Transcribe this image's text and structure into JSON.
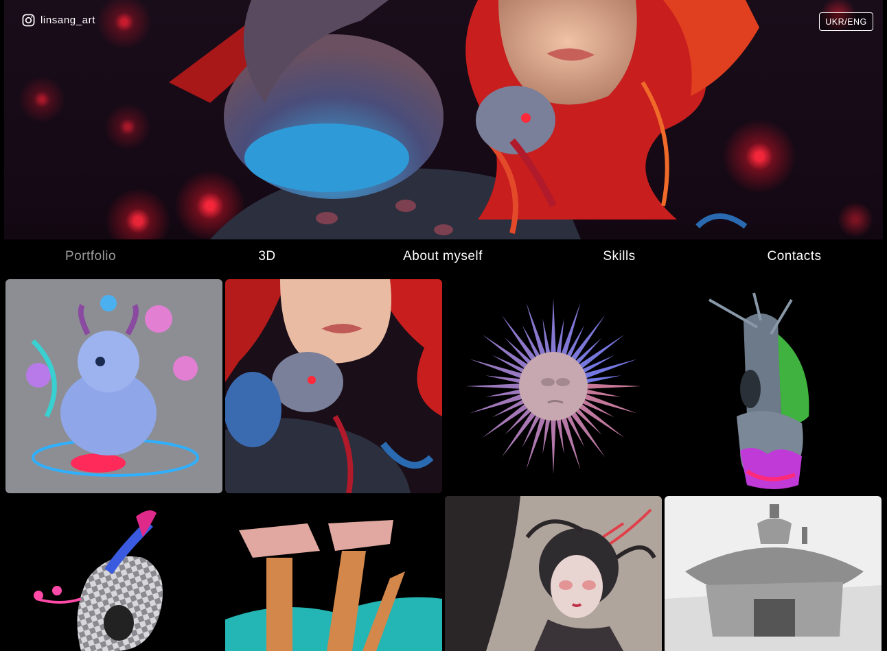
{
  "header": {
    "instagram_handle": "linsang_art",
    "instagram_icon": "instagram-icon",
    "language_toggle": "UKR/ENG"
  },
  "nav": {
    "items": [
      {
        "label": "Portfolio",
        "active": true
      },
      {
        "label": "3D",
        "active": false
      },
      {
        "label": "About myself",
        "active": false
      },
      {
        "label": "Skills",
        "active": false
      },
      {
        "label": "Contacts",
        "active": false
      }
    ]
  },
  "gallery": {
    "items": [
      {
        "name": "blue-creature-illustration"
      },
      {
        "name": "red-hair-girl-illustration"
      },
      {
        "name": "spiky-sun-3d-model"
      },
      {
        "name": "nailed-totem-3d-model"
      },
      {
        "name": "checkered-helmet-3d-model"
      },
      {
        "name": "broken-columns-3d-model"
      },
      {
        "name": "pale-girl-illustration"
      },
      {
        "name": "clay-house-3d-model"
      }
    ]
  },
  "colors": {
    "background": "#000000",
    "accent_red": "#e8402a",
    "accent_blue": "#3aa8e0",
    "nav_active": "#9a9a9a"
  }
}
